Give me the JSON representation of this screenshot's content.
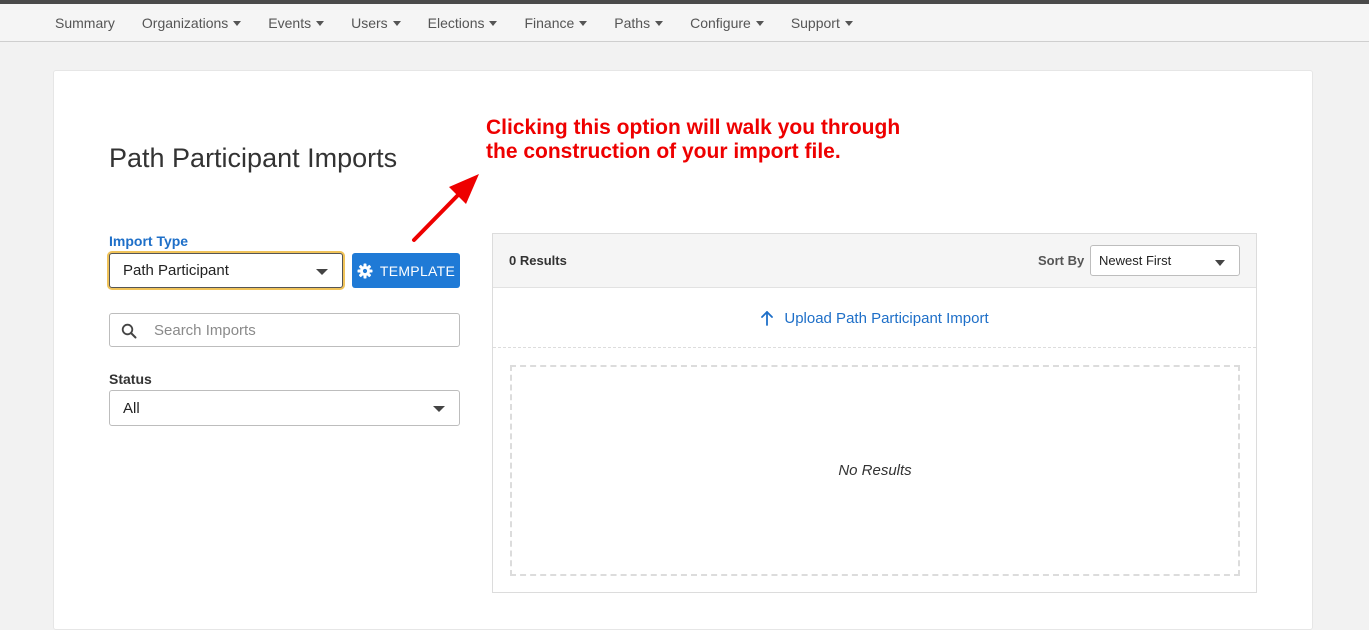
{
  "nav": {
    "items": [
      {
        "label": "Summary",
        "has_dropdown": false
      },
      {
        "label": "Organizations",
        "has_dropdown": true
      },
      {
        "label": "Events",
        "has_dropdown": true
      },
      {
        "label": "Users",
        "has_dropdown": true
      },
      {
        "label": "Elections",
        "has_dropdown": true
      },
      {
        "label": "Finance",
        "has_dropdown": true
      },
      {
        "label": "Paths",
        "has_dropdown": true
      },
      {
        "label": "Configure",
        "has_dropdown": true
      },
      {
        "label": "Support",
        "has_dropdown": true
      }
    ]
  },
  "page": {
    "title": "Path Participant Imports"
  },
  "annotation": {
    "line1": "Clicking this option will walk you through",
    "line2": "the construction of your import file.",
    "color": "#ee0000"
  },
  "filters": {
    "import_type_label": "Import Type",
    "import_type_value": "Path Participant",
    "template_button": "TEMPLATE",
    "search_placeholder": "Search Imports",
    "search_value": "",
    "status_label": "Status",
    "status_value": "All"
  },
  "results": {
    "count_label": "0 Results",
    "sort_label": "Sort By",
    "sort_value": "Newest First",
    "upload_label": "Upload Path Participant Import",
    "empty_text": "No Results"
  },
  "colors": {
    "accent": "#1f7ad6",
    "link": "#1e6fc8",
    "focus_ring": "#f0c35a"
  },
  "icons": {
    "template": "gear-icon",
    "search": "search-icon",
    "upload": "arrow-up-icon",
    "dropdown": "chevron-down-icon"
  }
}
